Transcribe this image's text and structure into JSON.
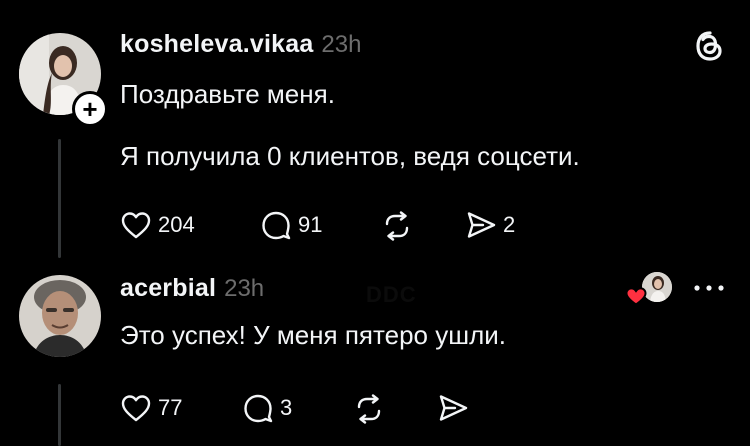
{
  "post": {
    "username": "kosheleva.vikaa",
    "time": "23h",
    "line1": "Поздравьте меня.",
    "line2": "Я получила 0 клиентов, ведя соцсети.",
    "actions": {
      "likes": "204",
      "replies": "91",
      "shares": "2"
    }
  },
  "reply": {
    "username": "acerbial",
    "time": "23h",
    "text": "Это успех! У меня пятеро ушли.",
    "actions": {
      "likes": "77",
      "replies": "3"
    }
  },
  "watermark": "DDC",
  "icons": {
    "app": "threads-logo-icon",
    "follow": "plus-icon",
    "like": "heart-icon",
    "reply": "comment-icon",
    "repost": "repost-icon",
    "share": "send-icon",
    "more": "more-icon"
  },
  "colors": {
    "background": "#000000",
    "text": "#f3f5f7",
    "muted": "#6d6d6d",
    "heart": "#ff3040"
  }
}
